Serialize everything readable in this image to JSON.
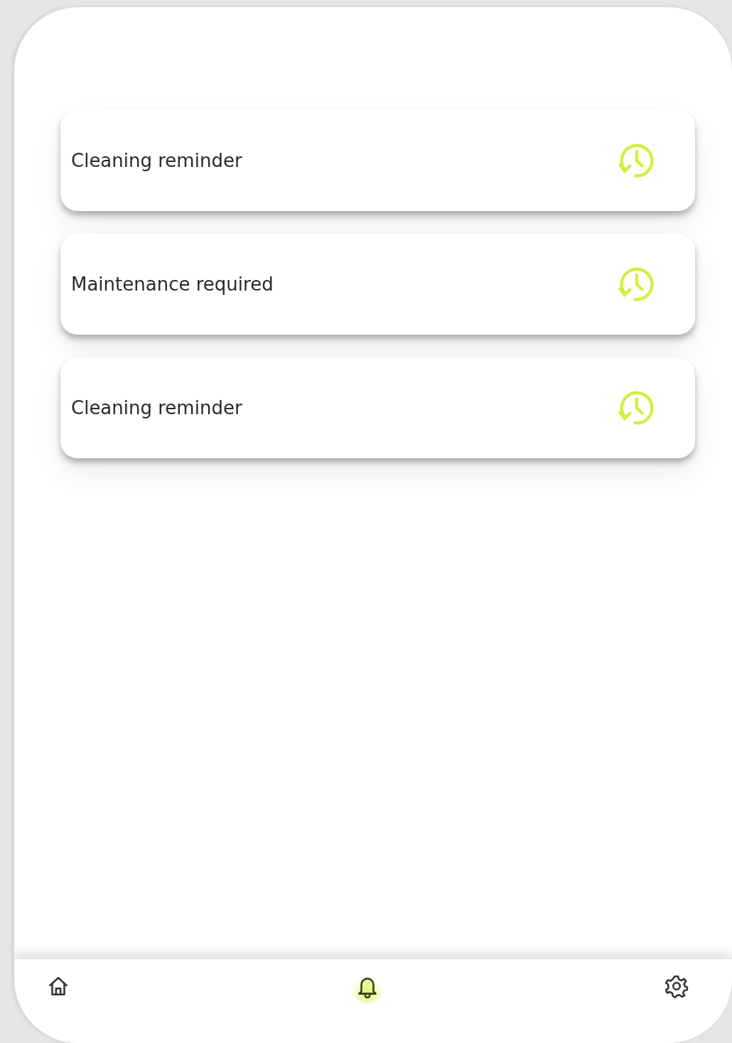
{
  "notifications": [
    {
      "title": "Cleaning reminder"
    },
    {
      "title": "Maintenance required"
    },
    {
      "title": "Cleaning reminder"
    }
  ],
  "nav": [
    {
      "kind": "home",
      "selected": false
    },
    {
      "kind": "bell",
      "selected": true
    },
    {
      "kind": "settings",
      "selected": false
    }
  ]
}
